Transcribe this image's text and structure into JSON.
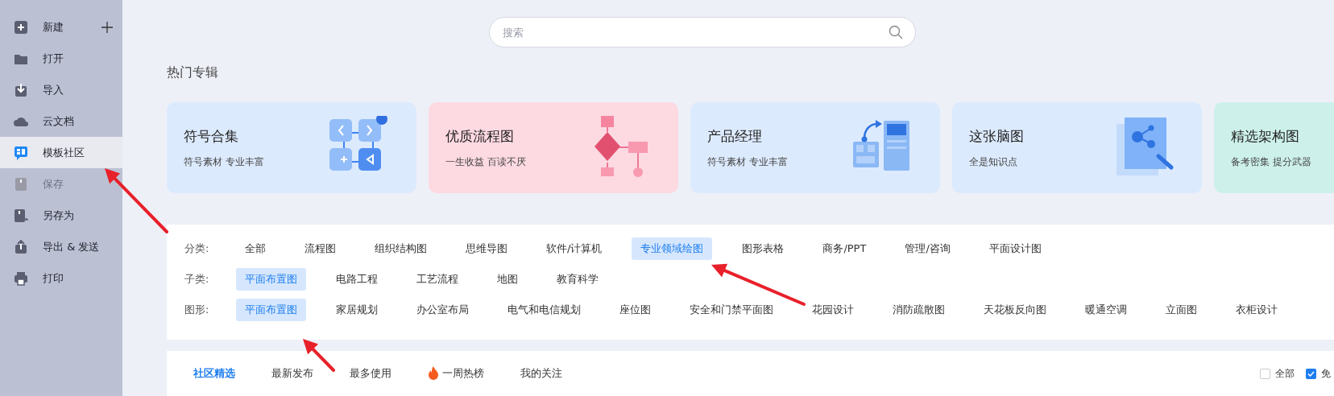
{
  "sidebar": {
    "items": [
      {
        "label": "新建",
        "kind": "new",
        "selected": false,
        "disabled": false
      },
      {
        "label": "打开",
        "kind": "item",
        "selected": false,
        "disabled": false
      },
      {
        "label": "导入",
        "kind": "item",
        "selected": false,
        "disabled": false
      },
      {
        "label": "云文档",
        "kind": "item",
        "selected": false,
        "disabled": false
      },
      {
        "label": "模板社区",
        "kind": "item",
        "selected": true,
        "disabled": false
      },
      {
        "label": "保存",
        "kind": "item",
        "selected": false,
        "disabled": true
      },
      {
        "label": "另存为",
        "kind": "item",
        "selected": false,
        "disabled": false
      },
      {
        "label": "导出 & 发送",
        "kind": "item",
        "selected": false,
        "disabled": false
      },
      {
        "label": "打印",
        "kind": "item",
        "selected": false,
        "disabled": false
      }
    ]
  },
  "search": {
    "placeholder": "搜索"
  },
  "featured": {
    "title": "热门专辑",
    "cards": [
      {
        "title": "符号合集",
        "subtitle": "符号素材 专业丰富",
        "color": "#dceafd"
      },
      {
        "title": "优质流程图",
        "subtitle": "一生收益 百读不厌",
        "color": "#fdd9e2"
      },
      {
        "title": "产品经理",
        "subtitle": "符号素材 专业丰富",
        "color": "#dceafd"
      },
      {
        "title": "这张脑图",
        "subtitle": "全是知识点",
        "color": "#dceafd"
      },
      {
        "title": "精选架构图",
        "subtitle": "备考密集 提分武器",
        "color": "#cdf1ea"
      }
    ]
  },
  "filters": [
    {
      "label": "分类:",
      "options": [
        {
          "label": "全部",
          "selected": false
        },
        {
          "label": "流程图",
          "selected": false
        },
        {
          "label": "组织结构图",
          "selected": false
        },
        {
          "label": "思维导图",
          "selected": false
        },
        {
          "label": "软件/计算机",
          "selected": false
        },
        {
          "label": "专业领域绘图",
          "selected": true
        },
        {
          "label": "图形表格",
          "selected": false
        },
        {
          "label": "商务/PPT",
          "selected": false
        },
        {
          "label": "管理/咨询",
          "selected": false
        },
        {
          "label": "平面设计图",
          "selected": false
        }
      ]
    },
    {
      "label": "子类:",
      "options": [
        {
          "label": "平面布置图",
          "selected": true
        },
        {
          "label": "电路工程",
          "selected": false
        },
        {
          "label": "工艺流程",
          "selected": false
        },
        {
          "label": "地图",
          "selected": false
        },
        {
          "label": "教育科学",
          "selected": false
        }
      ]
    },
    {
      "label": "图形:",
      "options": [
        {
          "label": "平面布置图",
          "selected": true
        },
        {
          "label": "家居规划",
          "selected": false
        },
        {
          "label": "办公室布局",
          "selected": false
        },
        {
          "label": "电气和电信规划",
          "selected": false
        },
        {
          "label": "座位图",
          "selected": false
        },
        {
          "label": "安全和门禁平面图",
          "selected": false
        },
        {
          "label": "花园设计",
          "selected": false
        },
        {
          "label": "消防疏散图",
          "selected": false
        },
        {
          "label": "天花板反向图",
          "selected": false
        },
        {
          "label": "暖通空调",
          "selected": false
        },
        {
          "label": "立面图",
          "selected": false
        },
        {
          "label": "衣柜设计",
          "selected": false
        }
      ]
    }
  ],
  "tabs": [
    {
      "label": "社区精选",
      "kind": "plain",
      "selected": true
    },
    {
      "label": "最新发布",
      "kind": "plain",
      "selected": false
    },
    {
      "label": "最多使用",
      "kind": "plain",
      "selected": false
    },
    {
      "label": "一周热榜",
      "kind": "hot",
      "selected": false
    },
    {
      "label": "我的关注",
      "kind": "plain",
      "selected": false
    }
  ],
  "checks": [
    {
      "label": "全部",
      "checked": false
    },
    {
      "label": "免",
      "checked": true
    }
  ]
}
